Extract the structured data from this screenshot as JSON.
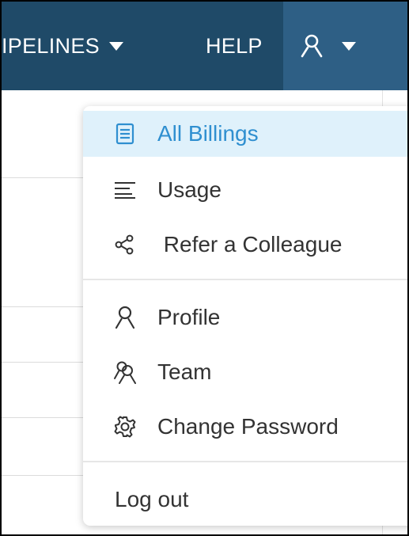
{
  "topbar": {
    "pipelines_label": "IPELINES",
    "help_label": "HELP"
  },
  "menu": {
    "items": [
      {
        "label": "All Billings",
        "icon": "billing-doc-icon",
        "active": true
      },
      {
        "label": "Usage",
        "icon": "list-lines-icon"
      },
      {
        "label": " Refer a Colleague",
        "icon": "share-icon"
      },
      {
        "label": "Profile",
        "icon": "person-icon"
      },
      {
        "label": "Team",
        "icon": "team-icon"
      },
      {
        "label": "Change Password",
        "icon": "gear-icon"
      }
    ],
    "logout_label": "Log out"
  },
  "colors": {
    "topbar": "#1f4a68",
    "user_menu_active": "#2e5f85",
    "active_item_bg": "#dff1fb",
    "active_item_text": "#2f8fd0",
    "menu_text": "#333333"
  }
}
